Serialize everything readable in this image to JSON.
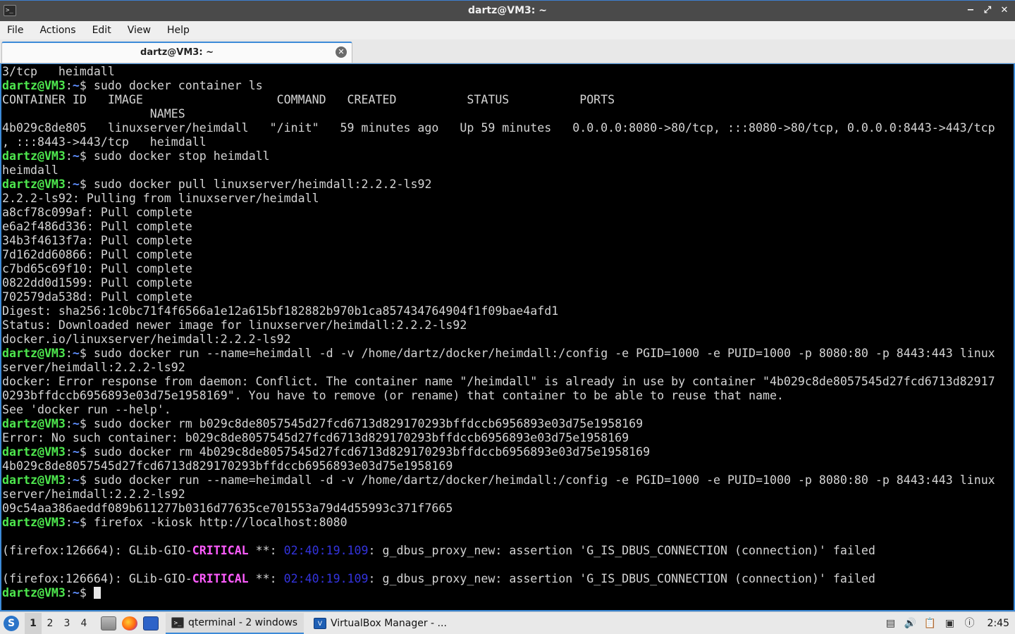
{
  "window": {
    "title": "dartz@VM3: ~"
  },
  "menu": [
    "File",
    "Actions",
    "Edit",
    "View",
    "Help"
  ],
  "tab": {
    "label": "dartz@VM3: ~"
  },
  "prompt": {
    "user": "dartz@VM3",
    "path": "~",
    "symbol": "$"
  },
  "terminal_lines": [
    {
      "type": "out",
      "text": "3/tcp   heimdall"
    },
    {
      "type": "cmd",
      "text": " sudo docker container ls"
    },
    {
      "type": "out",
      "text": "CONTAINER ID   IMAGE                   COMMAND   CREATED          STATUS          PORTS"
    },
    {
      "type": "out",
      "text": "                     NAMES"
    },
    {
      "type": "out",
      "text": "4b029c8de805   linuxserver/heimdall   \"/init\"   59 minutes ago   Up 59 minutes   0.0.0.0:8080->80/tcp, :::8080->80/tcp, 0.0.0.0:8443->443/tcp"
    },
    {
      "type": "out",
      "text": ", :::8443->443/tcp   heimdall"
    },
    {
      "type": "cmd",
      "text": " sudo docker stop heimdall"
    },
    {
      "type": "out",
      "text": "heimdall"
    },
    {
      "type": "cmd",
      "text": " sudo docker pull linuxserver/heimdall:2.2.2-ls92"
    },
    {
      "type": "out",
      "text": "2.2.2-ls92: Pulling from linuxserver/heimdall"
    },
    {
      "type": "out",
      "text": "a8cf78c099af: Pull complete"
    },
    {
      "type": "out",
      "text": "e6a2f486d336: Pull complete"
    },
    {
      "type": "out",
      "text": "34b3f4613f7a: Pull complete"
    },
    {
      "type": "out",
      "text": "7d162dd60866: Pull complete"
    },
    {
      "type": "out",
      "text": "c7bd65c69f10: Pull complete"
    },
    {
      "type": "out",
      "text": "0822dd0d1599: Pull complete"
    },
    {
      "type": "out",
      "text": "702579da538d: Pull complete"
    },
    {
      "type": "out",
      "text": "Digest: sha256:1c0bc71f4f6566a1e12a615bf182882b970b1ca857434764904f1f09bae4afd1"
    },
    {
      "type": "out",
      "text": "Status: Downloaded newer image for linuxserver/heimdall:2.2.2-ls92"
    },
    {
      "type": "out",
      "text": "docker.io/linuxserver/heimdall:2.2.2-ls92"
    },
    {
      "type": "cmd",
      "text": " sudo docker run --name=heimdall -d -v /home/dartz/docker/heimdall:/config -e PGID=1000 -e PUID=1000 -p 8080:80 -p 8443:443 linux"
    },
    {
      "type": "out",
      "text": "server/heimdall:2.2.2-ls92"
    },
    {
      "type": "out",
      "text": "docker: Error response from daemon: Conflict. The container name \"/heimdall\" is already in use by container \"4b029c8de8057545d27fcd6713d82917"
    },
    {
      "type": "out",
      "text": "0293bffdccb6956893e03d75e1958169\". You have to remove (or rename) that container to be able to reuse that name."
    },
    {
      "type": "out",
      "text": "See 'docker run --help'."
    },
    {
      "type": "cmd",
      "text": " sudo docker rm b029c8de8057545d27fcd6713d829170293bffdccb6956893e03d75e1958169"
    },
    {
      "type": "out",
      "text": "Error: No such container: b029c8de8057545d27fcd6713d829170293bffdccb6956893e03d75e1958169"
    },
    {
      "type": "cmd",
      "text": " sudo docker rm 4b029c8de8057545d27fcd6713d829170293bffdccb6956893e03d75e1958169"
    },
    {
      "type": "out",
      "text": "4b029c8de8057545d27fcd6713d829170293bffdccb6956893e03d75e1958169"
    },
    {
      "type": "cmd",
      "text": " sudo docker run --name=heimdall -d -v /home/dartz/docker/heimdall:/config -e PGID=1000 -e PUID=1000 -p 8080:80 -p 8443:443 linux"
    },
    {
      "type": "out",
      "text": "server/heimdall:2.2.2-ls92"
    },
    {
      "type": "out",
      "text": "09c54aa386aeddf089b611277b0316d77635ce701553a79d4d55993c371f7665"
    },
    {
      "type": "cmd",
      "text": " firefox -kiosk http://localhost:8080"
    },
    {
      "type": "blank",
      "text": ""
    },
    {
      "type": "crit",
      "pre": "(firefox:126664): GLib-GIO-",
      "crit": "CRITICAL",
      "mid": " **: ",
      "ts": "02:40:19.109",
      "post": ": g_dbus_proxy_new: assertion 'G_IS_DBUS_CONNECTION (connection)' failed"
    },
    {
      "type": "blank",
      "text": ""
    },
    {
      "type": "crit",
      "pre": "(firefox:126664): GLib-GIO-",
      "crit": "CRITICAL",
      "mid": " **: ",
      "ts": "02:40:19.109",
      "post": ": g_dbus_proxy_new: assertion 'G_IS_DBUS_CONNECTION (connection)' failed"
    },
    {
      "type": "cursor",
      "text": " "
    }
  ],
  "taskbar": {
    "workspaces": [
      "1",
      "2",
      "3",
      "4"
    ],
    "active_workspace": "1",
    "tasks": [
      {
        "label": "qterminal - 2 windows",
        "icon": "terminal-icon",
        "active": true
      },
      {
        "label": "VirtualBox Manager - ...",
        "icon": "virtualbox-icon",
        "active": false
      }
    ],
    "clock": "2:45"
  },
  "colors": {
    "prompt_user": "#4ee84e",
    "prompt_path": "#5f8fff",
    "critical": "#ff5cff",
    "timestamp": "#3333dd",
    "accent": "#3c8ad8"
  }
}
